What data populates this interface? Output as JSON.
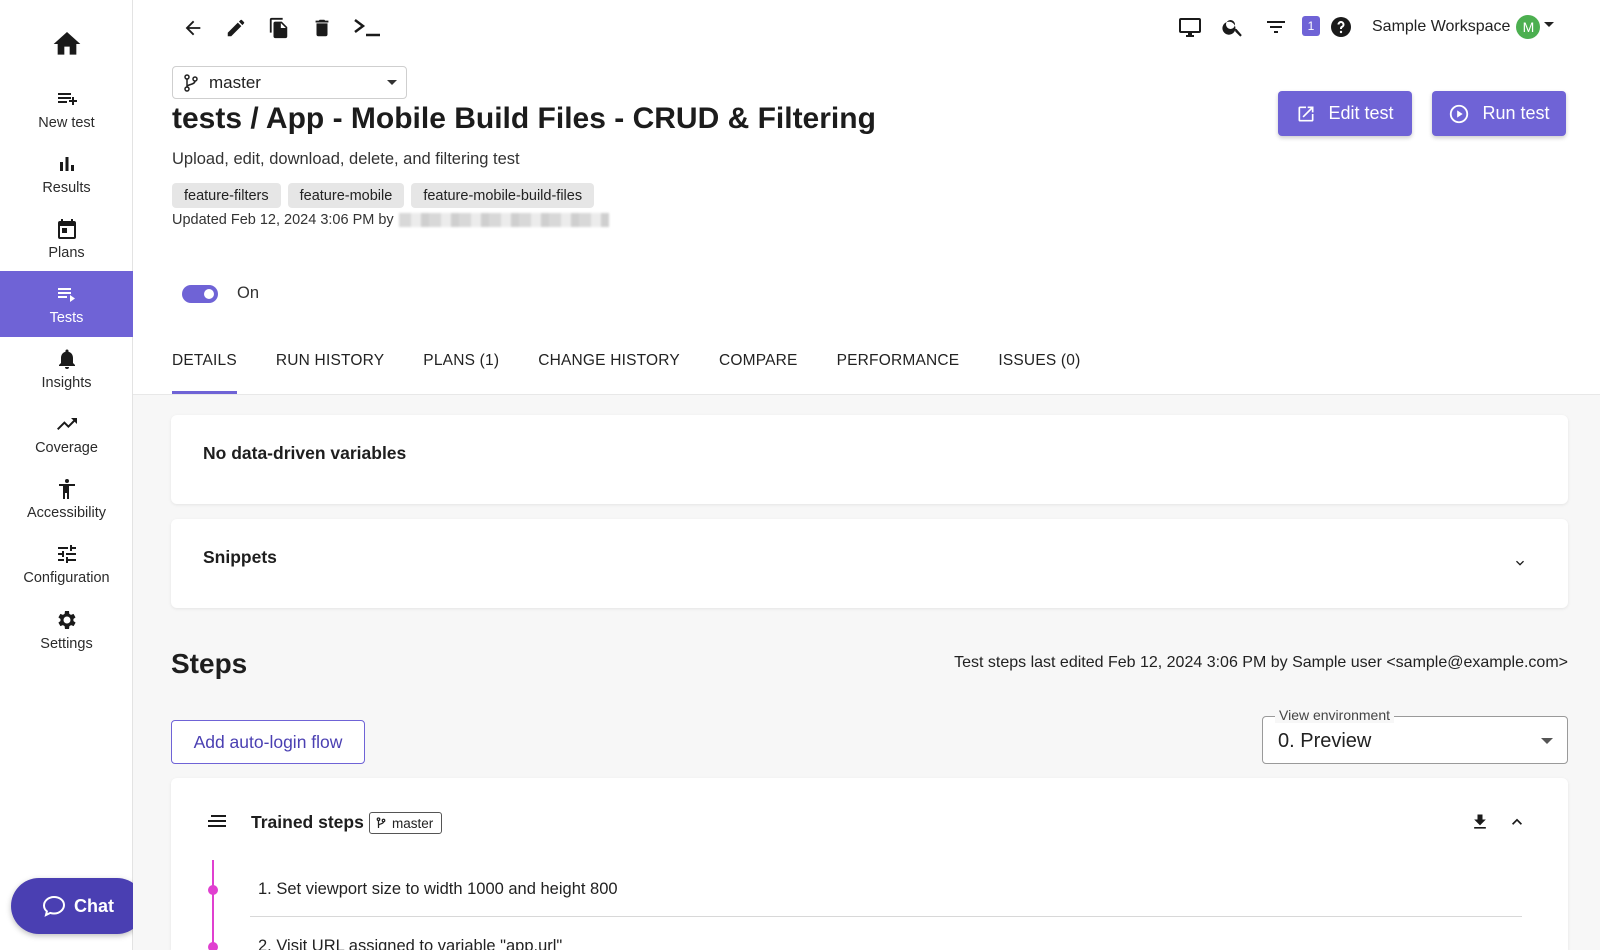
{
  "sidebar": {
    "items": [
      {
        "label": "New test",
        "icon": "playlist-add-icon"
      },
      {
        "label": "Results",
        "icon": "bar-chart-icon"
      },
      {
        "label": "Plans",
        "icon": "calendar-icon"
      },
      {
        "label": "Tests",
        "icon": "playlist-play-icon",
        "active": true
      },
      {
        "label": "Insights",
        "icon": "bell-icon"
      },
      {
        "label": "Coverage",
        "icon": "trending-up-icon"
      },
      {
        "label": "Accessibility",
        "icon": "accessibility-icon"
      },
      {
        "label": "Configuration",
        "icon": "tune-icon"
      },
      {
        "label": "Settings",
        "icon": "gear-icon"
      }
    ],
    "chat_label": "Chat"
  },
  "header": {
    "notification_count": "1",
    "workspace_name": "Sample Workspace",
    "avatar_initial": "M"
  },
  "branch": {
    "value": "master"
  },
  "test": {
    "title": "tests / App - Mobile Build Files - CRUD & Filtering",
    "description": "Upload, edit, download, delete, and filtering test",
    "tags": [
      "feature-filters",
      "feature-mobile",
      "feature-mobile-build-files"
    ],
    "updated_text": "Updated Feb 12, 2024 3:06 PM by"
  },
  "actions": {
    "edit_label": "Edit test",
    "run_label": "Run test"
  },
  "toggle": {
    "label": "On",
    "enabled": true
  },
  "tabs": [
    {
      "label": "DETAILS",
      "active": true
    },
    {
      "label": "RUN HISTORY"
    },
    {
      "label": "PLANS (1)"
    },
    {
      "label": "CHANGE HISTORY"
    },
    {
      "label": "COMPARE"
    },
    {
      "label": "PERFORMANCE"
    },
    {
      "label": "ISSUES (0)"
    }
  ],
  "cards": {
    "variables_title": "No data-driven variables",
    "snippets_title": "Snippets"
  },
  "steps": {
    "heading": "Steps",
    "meta": "Test steps last edited Feb 12, 2024 3:06 PM by Sample user <sample@example.com>",
    "auto_login_label": "Add auto-login flow",
    "env_label": "View environment",
    "env_value": "0. Preview",
    "trained_title": "Trained steps",
    "trained_branch": "master",
    "list": [
      "1. Set viewport size to width 1000 and height 800",
      "2. Visit URL assigned to variable \"app.url\""
    ]
  },
  "colors": {
    "accent": "#6f63d6",
    "chat": "#4a3fb2",
    "timeline": "#e040d0",
    "avatar": "#4caf50"
  }
}
